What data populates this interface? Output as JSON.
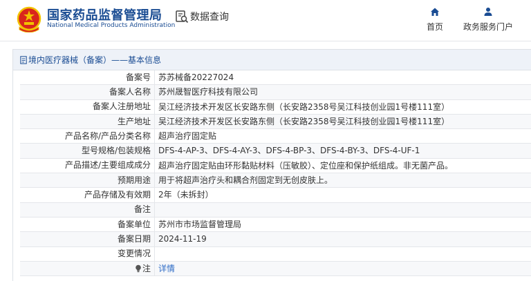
{
  "header": {
    "brand_cn": "国家药品监督管理局",
    "brand_en": "National Medical Products Administration",
    "query_label": "数据查询",
    "nav": [
      {
        "label": "首页",
        "icon": "home-icon"
      },
      {
        "label": "政务服务门户",
        "icon": "user-icon"
      }
    ]
  },
  "panel": {
    "title": "境内医疗器械（备案）——基本信息",
    "rows": [
      {
        "key": "备案号",
        "value": "苏苏械备20227024"
      },
      {
        "key": "备案人名称",
        "value": "苏州晟智医疗科技有限公司"
      },
      {
        "key": "备案人注册地址",
        "value": "吴江经济技术开发区长安路东侧（长安路2358号吴江科技创业园1号楼111室）"
      },
      {
        "key": "生产地址",
        "value": "吴江经济技术开发区长安路东侧（长安路2358号吴江科技创业园1号楼111室）"
      },
      {
        "key": "产品名称/产品分类名称",
        "value": "超声治疗固定贴"
      },
      {
        "key": "型号规格/包装规格",
        "value": "DFS-4-AP-3、DFS-4-AY-3、DFS-4-BP-3、DFS-4-BY-3、DFS-4-UF-1"
      },
      {
        "key": "产品描述/主要组成成分",
        "value": "超声治疗固定贴由环形黏贴材料（压敏胶）、定位座和保护纸组成。非无菌产品。"
      },
      {
        "key": "预期用途",
        "value": "用于将超声治疗头和耦合剂固定到无创皮肤上。"
      },
      {
        "key": "产品存储及有效期",
        "value": "2年（未拆封）"
      },
      {
        "key": "备注",
        "value": ""
      },
      {
        "key": "备案单位",
        "value": "苏州市市场监督管理局"
      },
      {
        "key": "备案日期",
        "value": "2024-11-19"
      },
      {
        "key": "变更情况",
        "value": ""
      },
      {
        "key": "注",
        "value": "详情"
      }
    ]
  },
  "colors": {
    "brand_blue": "#1a4c93",
    "link_blue": "#2f6cc6",
    "emblem_red": "#d9261c",
    "emblem_gold": "#f2c200"
  }
}
